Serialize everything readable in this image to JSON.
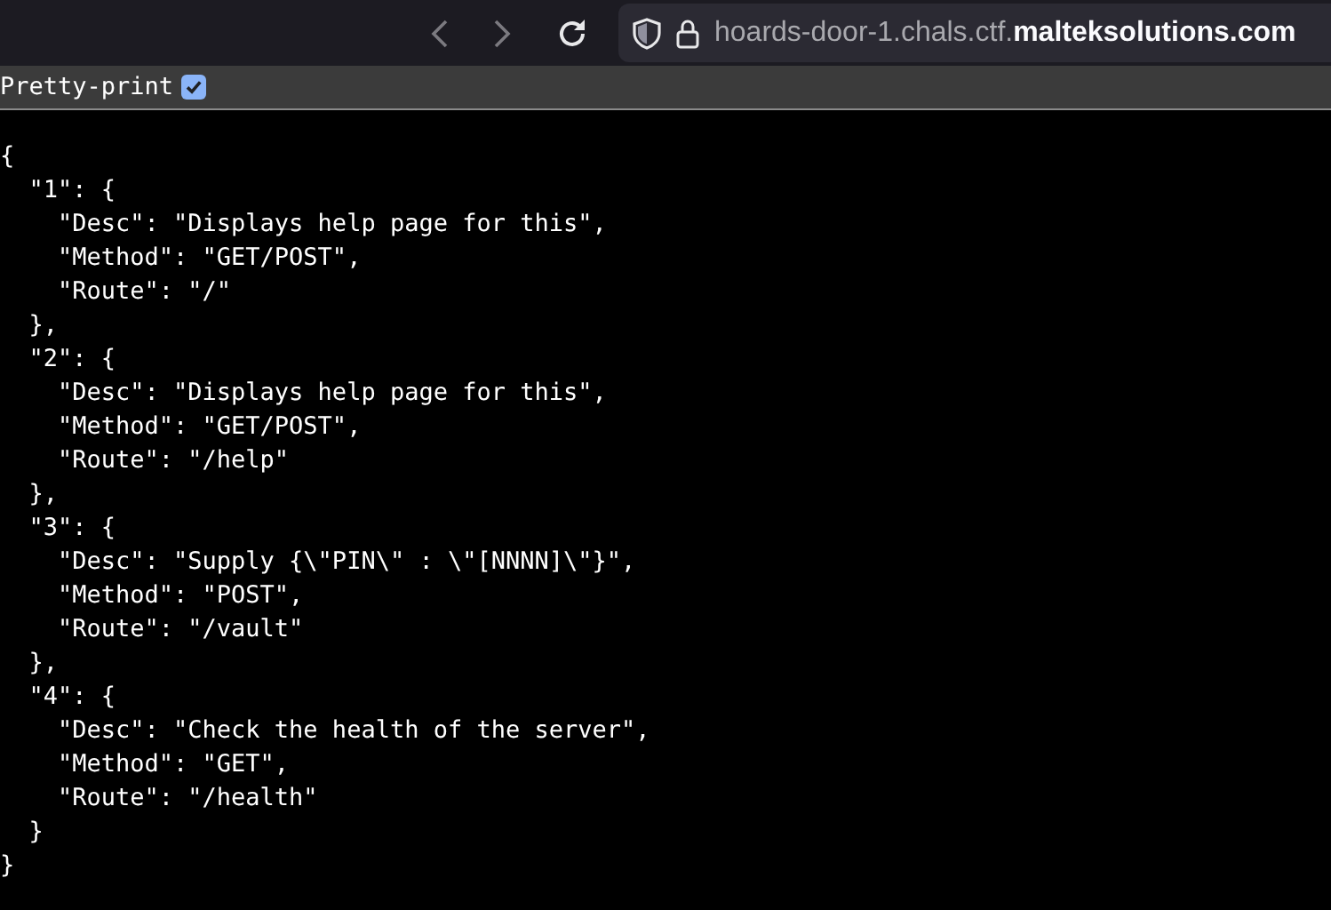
{
  "browser": {
    "url": "hoards-door-1.chals.ctf.**malteksolutions.com**"
  },
  "toolbar": {
    "label": "Pretty-print",
    "checked": true
  },
  "code_lines": [
    "{",
    "  \"1\": {",
    "    \"Desc\": \"Displays help page for this\",",
    "    \"Method\": \"GET/POST\",",
    "    \"Route\": \"/\"",
    "  },",
    "  \"2\": {",
    "    \"Desc\": \"Displays help page for this\",",
    "    \"Method\": \"GET/POST\",",
    "    \"Route\": \"/help\"",
    "  },",
    "  \"3\": {",
    "    \"Desc\": \"Supply {\\\"PIN\\\" : \\\"[NNNN]\\\"}\",",
    "    \"Method\": \"POST\",",
    "    \"Route\": \"/vault\"",
    "  },",
    "  \"4\": {",
    "    \"Desc\": \"Check the health of the server\",",
    "    \"Method\": \"GET\",",
    "    \"Route\": \"/health\"",
    "  }",
    "}"
  ]
}
